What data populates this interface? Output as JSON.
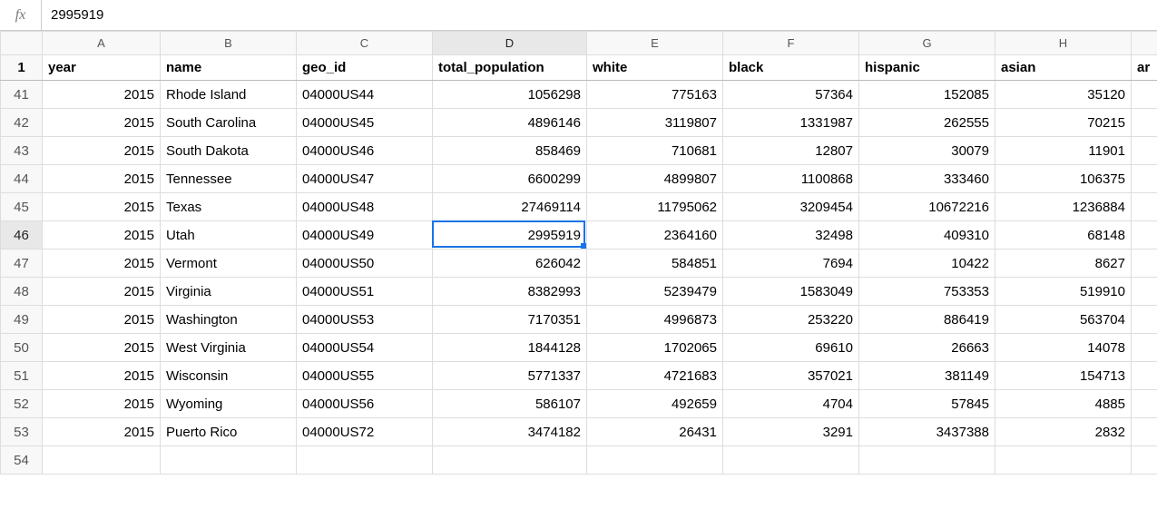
{
  "formula_bar": {
    "fx": "fx",
    "value": "2995919"
  },
  "columns": [
    "A",
    "B",
    "C",
    "D",
    "E",
    "F",
    "G",
    "H"
  ],
  "partial_col": "ar",
  "header_row_num": "1",
  "headers": {
    "A": "year",
    "B": "name",
    "C": "geo_id",
    "D": "total_population",
    "E": "white",
    "F": "black",
    "G": "hispanic",
    "H": "asian"
  },
  "rows": [
    {
      "n": "41",
      "A": "2015",
      "B": "Rhode Island",
      "C": "04000US44",
      "D": "1056298",
      "E": "775163",
      "F": "57364",
      "G": "152085",
      "H": "35120"
    },
    {
      "n": "42",
      "A": "2015",
      "B": "South Carolina",
      "C": "04000US45",
      "D": "4896146",
      "E": "3119807",
      "F": "1331987",
      "G": "262555",
      "H": "70215"
    },
    {
      "n": "43",
      "A": "2015",
      "B": "South Dakota",
      "C": "04000US46",
      "D": "858469",
      "E": "710681",
      "F": "12807",
      "G": "30079",
      "H": "11901"
    },
    {
      "n": "44",
      "A": "2015",
      "B": "Tennessee",
      "C": "04000US47",
      "D": "6600299",
      "E": "4899807",
      "F": "1100868",
      "G": "333460",
      "H": "106375"
    },
    {
      "n": "45",
      "A": "2015",
      "B": "Texas",
      "C": "04000US48",
      "D": "27469114",
      "E": "11795062",
      "F": "3209454",
      "G": "10672216",
      "H": "1236884"
    },
    {
      "n": "46",
      "A": "2015",
      "B": "Utah",
      "C": "04000US49",
      "D": "2995919",
      "E": "2364160",
      "F": "32498",
      "G": "409310",
      "H": "68148"
    },
    {
      "n": "47",
      "A": "2015",
      "B": "Vermont",
      "C": "04000US50",
      "D": "626042",
      "E": "584851",
      "F": "7694",
      "G": "10422",
      "H": "8627"
    },
    {
      "n": "48",
      "A": "2015",
      "B": "Virginia",
      "C": "04000US51",
      "D": "8382993",
      "E": "5239479",
      "F": "1583049",
      "G": "753353",
      "H": "519910"
    },
    {
      "n": "49",
      "A": "2015",
      "B": "Washington",
      "C": "04000US53",
      "D": "7170351",
      "E": "4996873",
      "F": "253220",
      "G": "886419",
      "H": "563704"
    },
    {
      "n": "50",
      "A": "2015",
      "B": "West Virginia",
      "C": "04000US54",
      "D": "1844128",
      "E": "1702065",
      "F": "69610",
      "G": "26663",
      "H": "14078"
    },
    {
      "n": "51",
      "A": "2015",
      "B": "Wisconsin",
      "C": "04000US55",
      "D": "5771337",
      "E": "4721683",
      "F": "357021",
      "G": "381149",
      "H": "154713"
    },
    {
      "n": "52",
      "A": "2015",
      "B": "Wyoming",
      "C": "04000US56",
      "D": "586107",
      "E": "492659",
      "F": "4704",
      "G": "57845",
      "H": "4885"
    },
    {
      "n": "53",
      "A": "2015",
      "B": "Puerto Rico",
      "C": "04000US72",
      "D": "3474182",
      "E": "26431",
      "F": "3291",
      "G": "3437388",
      "H": "2832"
    }
  ],
  "empty_row": "54",
  "selection": {
    "row": "46",
    "col": "D"
  }
}
